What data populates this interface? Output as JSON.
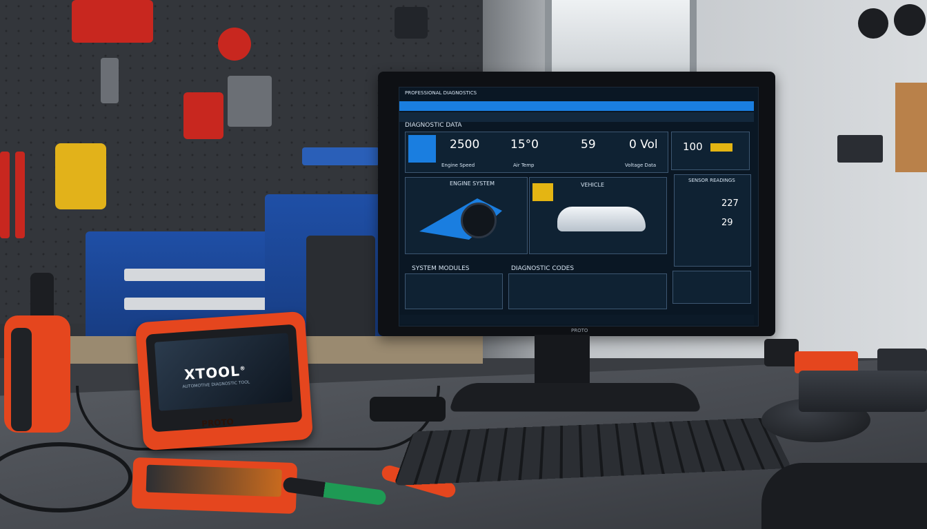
{
  "scene": {
    "description_tag": "workshop-desk-with-diagnostic-tools"
  },
  "monitor": {
    "brand": "PROTO",
    "screen": {
      "app_title": "PROFESSIONAL DIAGNOSTICS",
      "section_title": "DIAGNOSTIC DATA",
      "gauges": [
        {
          "value": "2500",
          "label": "Engine Speed"
        },
        {
          "value": "15°0",
          "label": "Air Temp"
        },
        {
          "value": "59",
          "label": ""
        },
        {
          "value": "0 Vol",
          "label": "Voltage Data"
        },
        {
          "value": "100",
          "label": ""
        }
      ],
      "engine_panel_title": "ENGINE SYSTEM",
      "vehicle_panel_title": "VEHICLE",
      "readings_panel_title": "SENSOR READINGS",
      "readings": [
        "227",
        "29"
      ],
      "bottom_left_title": "SYSTEM MODULES",
      "bottom_mid_title": "DIAGNOSTIC CODES"
    }
  },
  "device": {
    "logo": "XTOOL",
    "logo_mark": "®",
    "subtitle": "AUTOMOTIVE DIAGNOSTIC TOOL",
    "brand_plate": "PROTO"
  },
  "colors": {
    "accent_orange": "#e5461e",
    "screen_blue": "#1a7ee0",
    "cabinet_blue": "#1f4fa6",
    "badge_yellow": "#e4b513"
  }
}
